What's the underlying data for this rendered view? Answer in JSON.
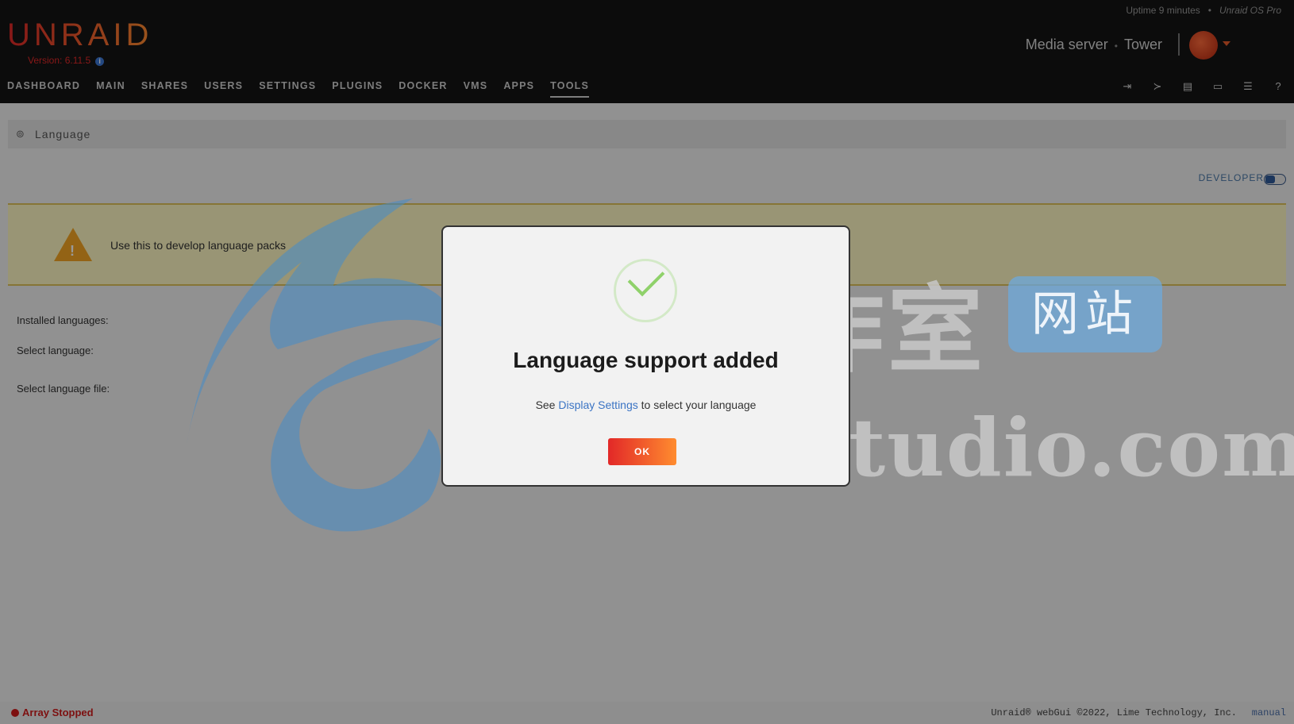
{
  "header": {
    "uptime": "Uptime 9 minutes",
    "edition": "Unraid OS Pro",
    "logo": "UNRAID",
    "version": "Version: 6.11.5",
    "server_desc": "Media server",
    "server_name": "Tower"
  },
  "nav": {
    "items": [
      "DASHBOARD",
      "MAIN",
      "SHARES",
      "USERS",
      "SETTINGS",
      "PLUGINS",
      "DOCKER",
      "VMS",
      "APPS",
      "TOOLS"
    ],
    "active": "TOOLS",
    "icons": [
      "logout-icon",
      "terminal-icon",
      "feedback-icon",
      "display-icon",
      "log-icon",
      "help-icon"
    ]
  },
  "page": {
    "title": "Language",
    "developer_label": "DEVELOPER",
    "notice": "Use this to develop language packs",
    "labels": [
      "Installed languages:",
      "Select language:",
      "Select language file:"
    ]
  },
  "footer": {
    "status": "Array Stopped",
    "copyright": "Unraid® webGui ©2022, Lime Technology, Inc.",
    "manual": "manual"
  },
  "watermark": {
    "cn": "腾龙工作室",
    "badge": "网站",
    "en": "Tenlonstudio.com"
  },
  "modal": {
    "title": "Language support added",
    "text_before": "See",
    "link": "Display Settings",
    "text_after": "to select your language",
    "ok": "OK"
  },
  "colors": {
    "brand_start": "#e22828",
    "brand_end": "#ff8c2f",
    "header_bg": "#141414",
    "link": "#3b74c4",
    "success": "#8fd16a"
  }
}
